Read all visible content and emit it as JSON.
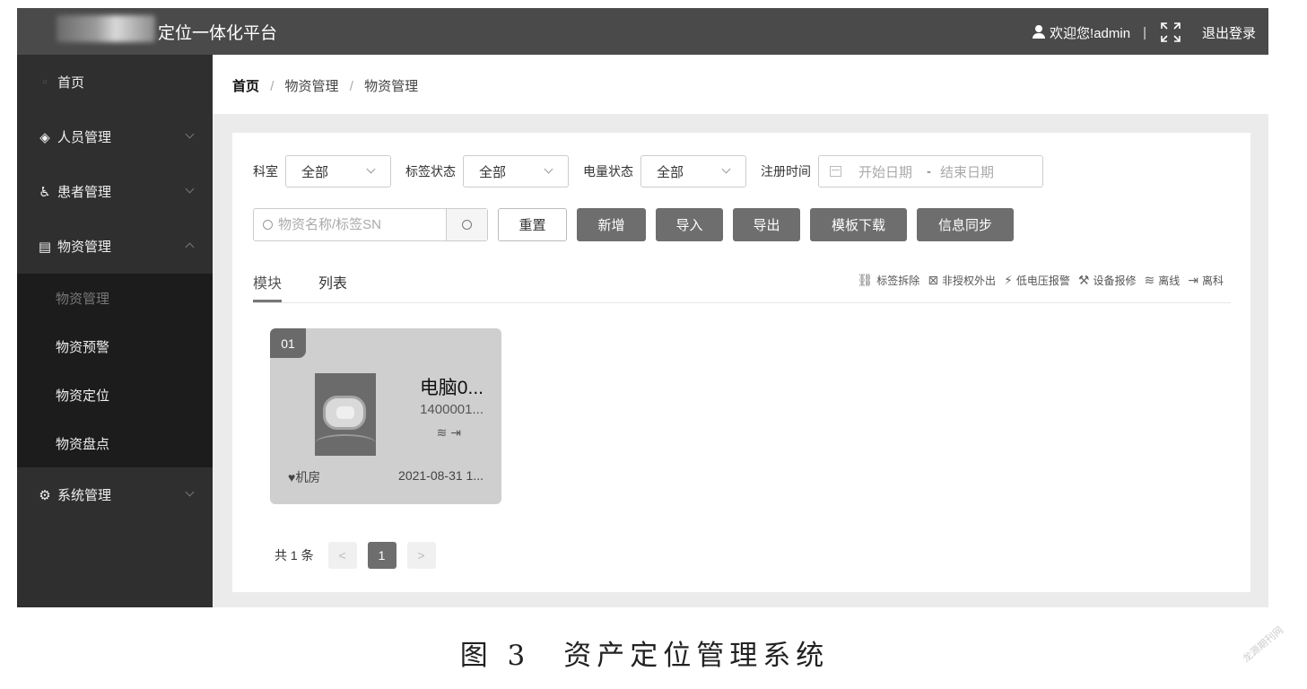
{
  "header": {
    "app_title": "定位一体化平台",
    "welcome": "欢迎您!admin",
    "separator": "|",
    "logout": "退出登录",
    "icons": [
      "user-icon",
      "fullscreen-icon"
    ]
  },
  "sidebar": {
    "items": [
      {
        "label": "首页",
        "icon": "home-icon",
        "glyph": "▫"
      },
      {
        "label": "人员管理",
        "icon": "diamond-icon",
        "glyph": "◈"
      },
      {
        "label": "患者管理",
        "icon": "wheelchair-icon",
        "glyph": "♿"
      },
      {
        "label": "物资管理",
        "icon": "list-icon",
        "glyph": "▤"
      },
      {
        "label": "系统管理",
        "icon": "gear-icon",
        "glyph": "⚙"
      }
    ],
    "submenu": [
      "物资管理",
      "物资预警",
      "物资定位",
      "物资盘点"
    ],
    "active_sub": "物资管理"
  },
  "breadcrumb": {
    "home": "首页",
    "sep": "/",
    "level1": "物资管理",
    "level2": "物资管理"
  },
  "filters": {
    "dept_label": "科室",
    "dept_value": "全部",
    "tag_label": "标签状态",
    "tag_value": "全部",
    "power_label": "电量状态",
    "power_value": "全部",
    "reg_label": "注册时间",
    "start_placeholder": "开始日期",
    "date_sep": "-",
    "end_placeholder": "结束日期"
  },
  "actions": {
    "search_placeholder": "物资名称/标签SN",
    "reset": "重置",
    "add": "新增",
    "import": "导入",
    "export": "导出",
    "template": "模板下载",
    "sync": "信息同步"
  },
  "tabs": {
    "block": "模块",
    "list": "列表"
  },
  "legend": [
    {
      "icon": "tag-remove-icon",
      "glyph": "⛓",
      "label": "标签拆除"
    },
    {
      "icon": "unauthorized-exit-icon",
      "glyph": "⊠",
      "label": "非授权外出"
    },
    {
      "icon": "low-voltage-icon",
      "glyph": "⚡",
      "label": "低电压报警"
    },
    {
      "icon": "repair-icon",
      "glyph": "⚒",
      "label": "设备报修"
    },
    {
      "icon": "offline-icon",
      "glyph": "≋",
      "label": "离线"
    },
    {
      "icon": "leave-dept-icon",
      "glyph": "⇥",
      "label": "离科"
    }
  ],
  "card": {
    "index": "01",
    "name": "电脑0...",
    "sn": "1400001...",
    "status_icons": "≋ ⇥",
    "location": "♥机房",
    "time": "2021-08-31 1..."
  },
  "pager": {
    "total": "共 1 条",
    "prev": "<",
    "current": "1",
    "next": ">"
  },
  "caption": "图 3　资产定位管理系统",
  "watermark": "龙源期刊网"
}
